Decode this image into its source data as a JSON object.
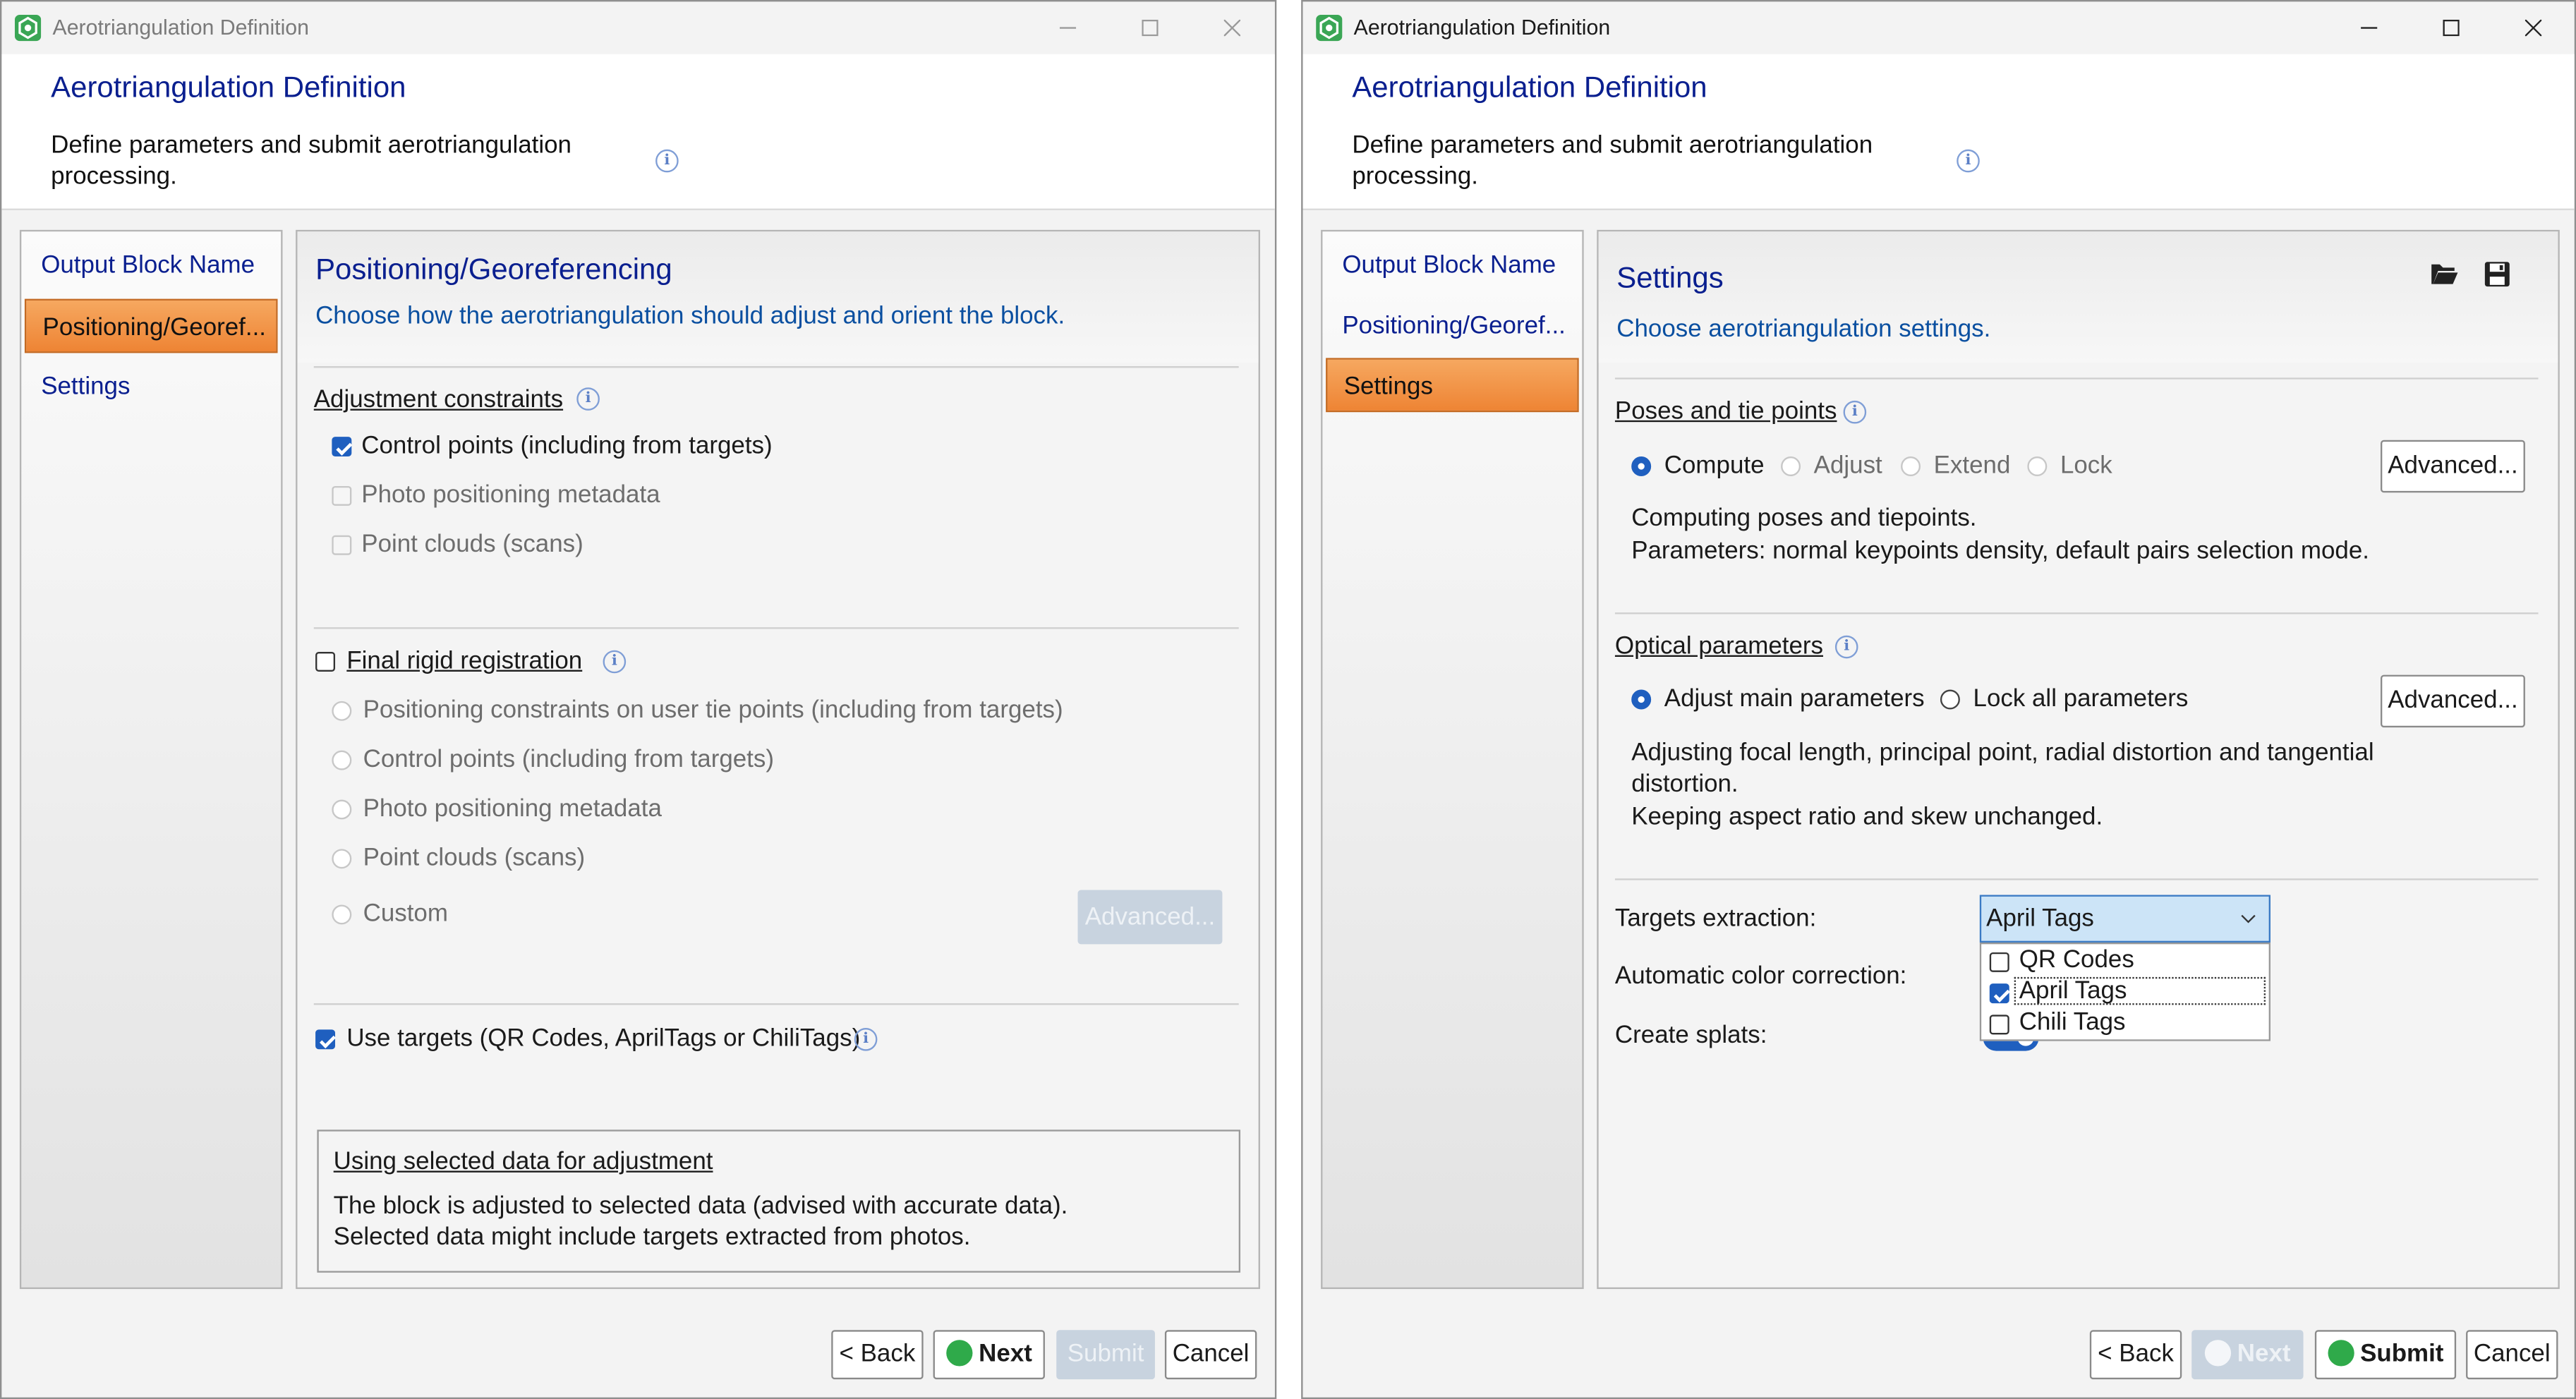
{
  "left_window": {
    "title": "Aerotriangulation Definition",
    "header_title": "Aerotriangulation Definition",
    "header_subtitle": "Define parameters and submit aerotriangulation processing.",
    "nav": [
      "Output Block Name",
      "Positioning/Georef...",
      "Settings"
    ],
    "selected_nav": "Positioning/Georef...",
    "panel": {
      "title": "Positioning/Georeferencing",
      "description": "Choose how the aerotriangulation should adjust and orient the block.",
      "adjustment_constraints": {
        "label": "Adjustment constraints",
        "options": [
          {
            "label": "Control points (including from targets)",
            "checked": true,
            "enabled": true
          },
          {
            "label": "Photo positioning metadata",
            "checked": false,
            "enabled": false
          },
          {
            "label": "Point clouds (scans)",
            "checked": false,
            "enabled": false
          }
        ]
      },
      "final_rigid_registration": {
        "label": "Final rigid registration",
        "checked": false,
        "options": [
          "Positioning constraints on user tie points (including from targets)",
          "Control points (including from targets)",
          "Photo positioning metadata",
          "Point clouds (scans)",
          "Custom"
        ],
        "advanced_label": "Advanced..."
      },
      "use_targets": {
        "label": "Use targets (QR Codes, AprilTags or ChiliTags)",
        "checked": true
      },
      "info_box": {
        "title": "Using selected data for adjustment",
        "line1": "The block is adjusted to selected data (advised with accurate data).",
        "line2": "Selected data might include targets extracted from photos."
      }
    },
    "buttons": {
      "back": "< Back",
      "next": "Next",
      "submit": "Submit",
      "cancel": "Cancel"
    }
  },
  "right_window": {
    "title": "Aerotriangulation Definition",
    "header_title": "Aerotriangulation Definition",
    "header_subtitle": "Define parameters and submit aerotriangulation processing.",
    "nav": [
      "Output Block Name",
      "Positioning/Georef...",
      "Settings"
    ],
    "selected_nav": "Settings",
    "panel": {
      "title": "Settings",
      "description": "Choose aerotriangulation settings.",
      "poses": {
        "label": "Poses and tie points",
        "options": [
          "Compute",
          "Adjust",
          "Extend",
          "Lock"
        ],
        "selected": "Compute",
        "advanced_label": "Advanced...",
        "summary_line1": "Computing poses and tiepoints.",
        "summary_line2": "Parameters: normal keypoints density, default pairs selection mode."
      },
      "optical": {
        "label": "Optical parameters",
        "options": [
          "Adjust main parameters",
          "Lock all parameters"
        ],
        "selected": "Adjust main parameters",
        "advanced_label": "Advanced...",
        "summary_line1": "Adjusting focal length, principal point, radial distortion and tangential",
        "summary_line2": "distortion.",
        "summary_line3": "Keeping aspect ratio and skew unchanged."
      },
      "targets_extraction": {
        "label": "Targets extraction:",
        "value": "April Tags",
        "options": [
          {
            "label": "QR Codes",
            "checked": false
          },
          {
            "label": "April Tags",
            "checked": true
          },
          {
            "label": "Chili Tags",
            "checked": false
          }
        ]
      },
      "color_correction_label": "Automatic color correction:",
      "create_splats_label": "Create splats:"
    },
    "buttons": {
      "back": "< Back",
      "next": "Next",
      "submit": "Submit",
      "cancel": "Cancel"
    }
  },
  "colors": {
    "accent_blue": "#0a1f8f",
    "selected_orange": "#f09040",
    "check_blue": "#1f5fbf",
    "go_green": "#2faa4a"
  }
}
